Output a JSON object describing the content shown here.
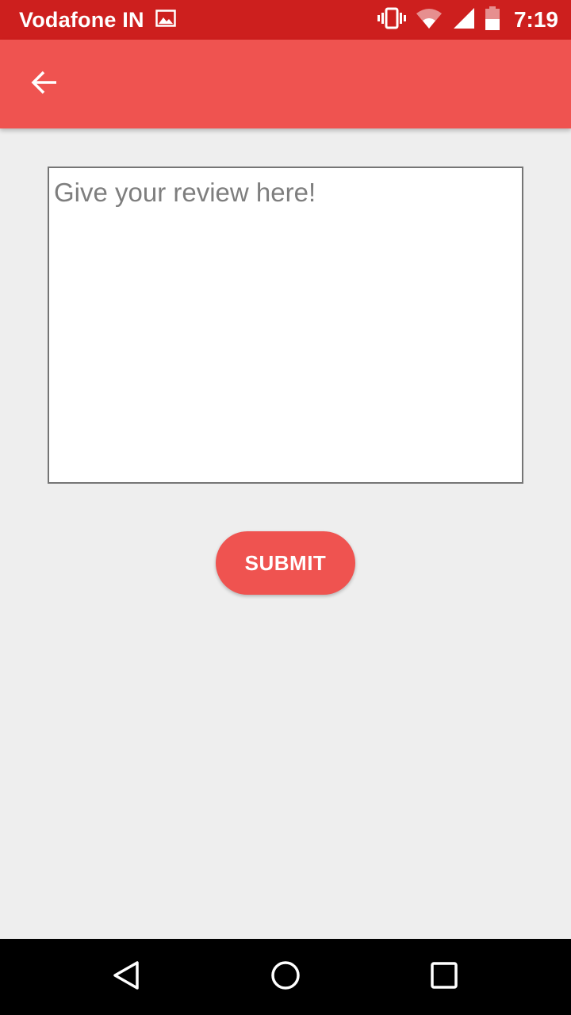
{
  "status_bar": {
    "carrier": "Vodafone IN",
    "time": "7:19",
    "icons": [
      "gallery-notification-icon",
      "vibrate-icon",
      "wifi-icon",
      "cell-signal-icon",
      "battery-icon"
    ]
  },
  "app_bar": {
    "back_icon": "arrow-back-icon",
    "color": "#ef5350"
  },
  "review": {
    "placeholder": "Give your review here!",
    "value": ""
  },
  "submit": {
    "label": "SUBMIT"
  },
  "nav_bar": {
    "icons": [
      "back-triangle-icon",
      "home-circle-icon",
      "recents-square-icon"
    ]
  },
  "colors": {
    "status_bar": "#cd1f1e",
    "accent": "#ef5350",
    "background": "#eeeeee"
  }
}
